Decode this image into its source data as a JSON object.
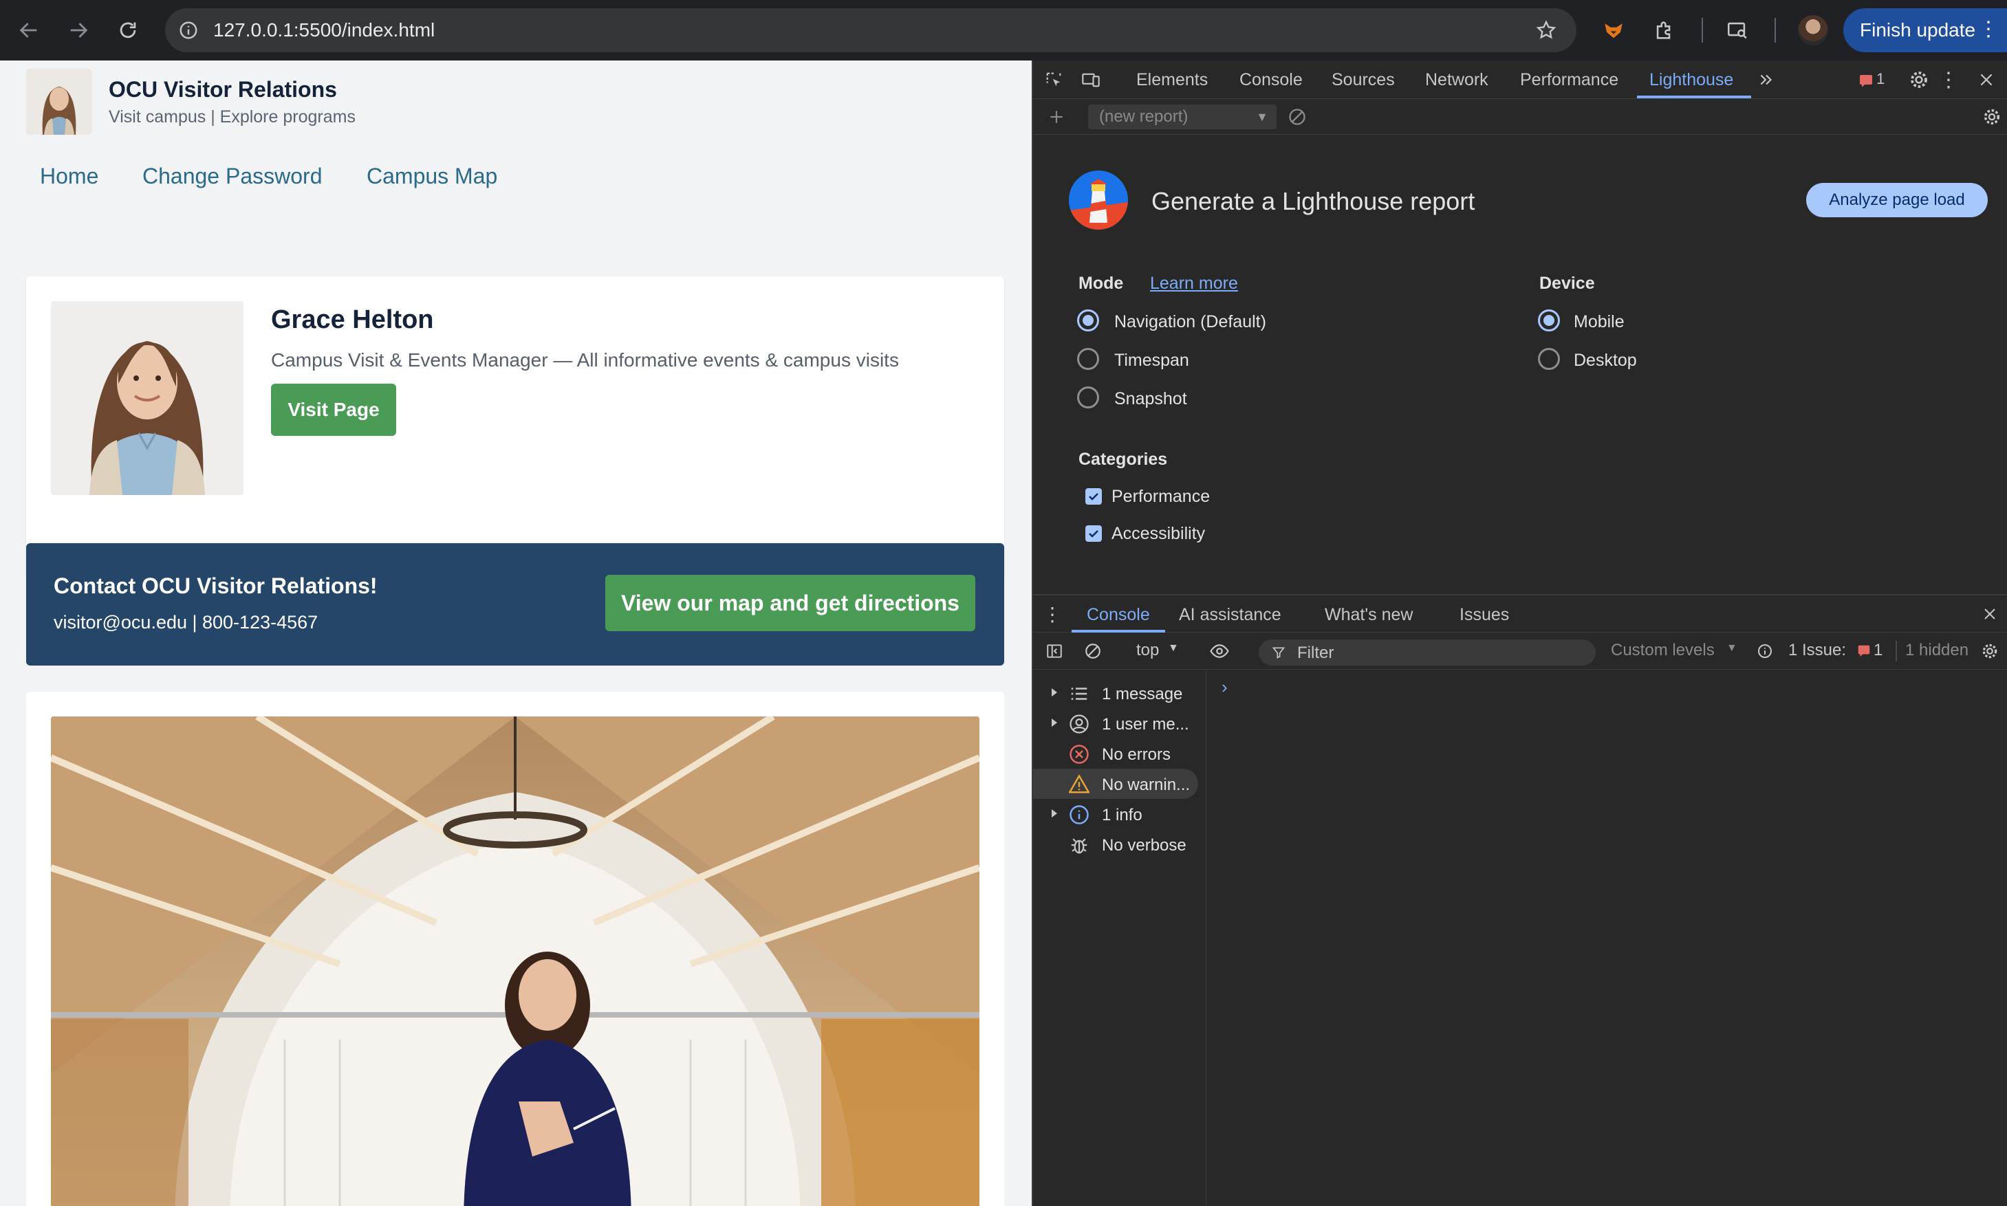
{
  "browser": {
    "url": "127.0.0.1:5500/index.html",
    "finish_update_label": "Finish update"
  },
  "site": {
    "title": "OCU Visitor Relations",
    "subtitle": "Visit campus | Explore programs",
    "nav": [
      "Home",
      "Change Password",
      "Campus Map"
    ],
    "profile": {
      "name": "Grace Helton",
      "role": "Campus Visit & Events Manager — All informative events & campus visits",
      "button": "Visit Page"
    },
    "contact": {
      "title": "Contact OCU Visitor Relations!",
      "info": "visitor@ocu.edu | 800-123-4567",
      "button": "View our map and get directions"
    }
  },
  "devtools": {
    "tabs": [
      "Elements",
      "Console",
      "Sources",
      "Network",
      "Performance",
      "Lighthouse"
    ],
    "active_tab": "Lighthouse",
    "issues_count": "1",
    "lighthouse": {
      "report_select": "(new report)",
      "title": "Generate a Lighthouse report",
      "analyze_button": "Analyze page load",
      "mode_label": "Mode",
      "learn_more": "Learn more",
      "modes": [
        "Navigation (Default)",
        "Timespan",
        "Snapshot"
      ],
      "device_label": "Device",
      "devices": [
        "Mobile",
        "Desktop"
      ],
      "categories_label": "Categories",
      "categories": [
        "Performance",
        "Accessibility"
      ]
    },
    "drawer": {
      "tabs": [
        "Console",
        "AI assistance",
        "What's new",
        "Issues"
      ],
      "context": "top",
      "filter_placeholder": "Filter",
      "levels": "Custom levels",
      "issue_label": "1 Issue:",
      "issue_count": "1",
      "hidden": "1 hidden",
      "sidebar": [
        "1 message",
        "1 user me...",
        "No errors",
        "No warnin...",
        "1 info",
        "No verbose"
      ]
    },
    "colors": {
      "accent": "#7cacf8",
      "bg": "#282828",
      "button_green": "#4a9b55",
      "banner": "#254669"
    }
  }
}
